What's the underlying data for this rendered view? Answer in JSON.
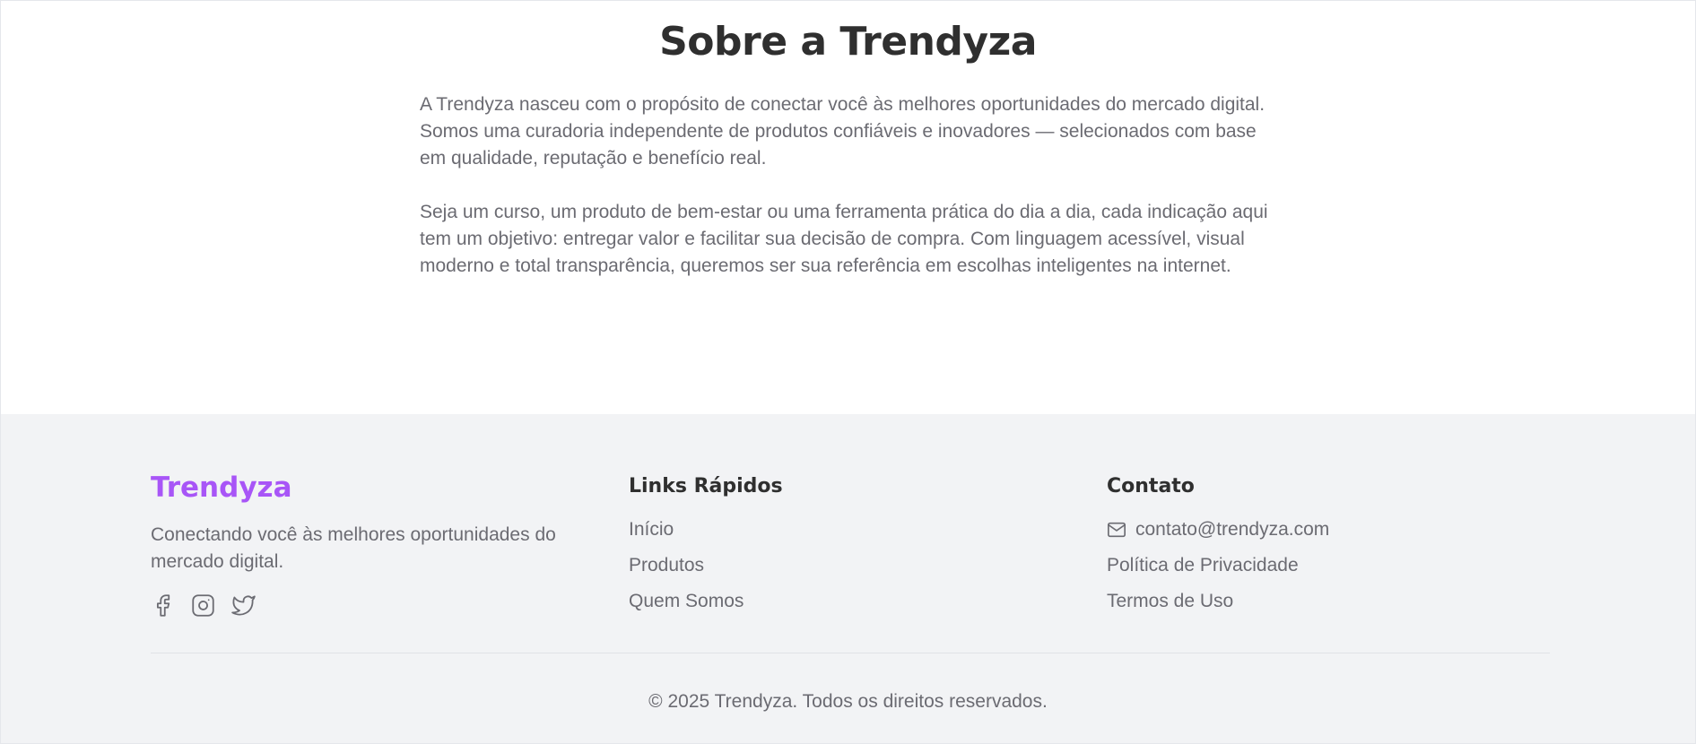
{
  "about": {
    "title": "Sobre a Trendyza",
    "paragraphs": [
      "A Trendyza nasceu com o propósito de conectar você às melhores oportunidades do mercado digital. Somos uma curadoria independente de produtos confiáveis e inovadores — selecionados com base em qualidade, reputação e benefício real.",
      "Seja um curso, um produto de bem-estar ou uma ferramenta prática do dia a dia, cada indicação aqui tem um objetivo: entregar valor e facilitar sua decisão de compra. Com linguagem acessível, visual moderno e total transparência, queremos ser sua referência em escolhas inteligentes na internet."
    ]
  },
  "footer": {
    "brand": "Trendyza",
    "brand_color": "#a855f7",
    "tagline": "Conectando você às melhores oportunidades do mercado digital.",
    "socials": [
      "facebook-icon",
      "instagram-icon",
      "twitter-icon"
    ],
    "quick_links": {
      "title": "Links Rápidos",
      "items": [
        "Início",
        "Produtos",
        "Quem Somos"
      ]
    },
    "contact": {
      "title": "Contato",
      "email": "contato@trendyza.com",
      "items": [
        "Política de Privacidade",
        "Termos de Uso"
      ]
    },
    "copyright": "© 2025 Trendyza. Todos os direitos reservados."
  }
}
